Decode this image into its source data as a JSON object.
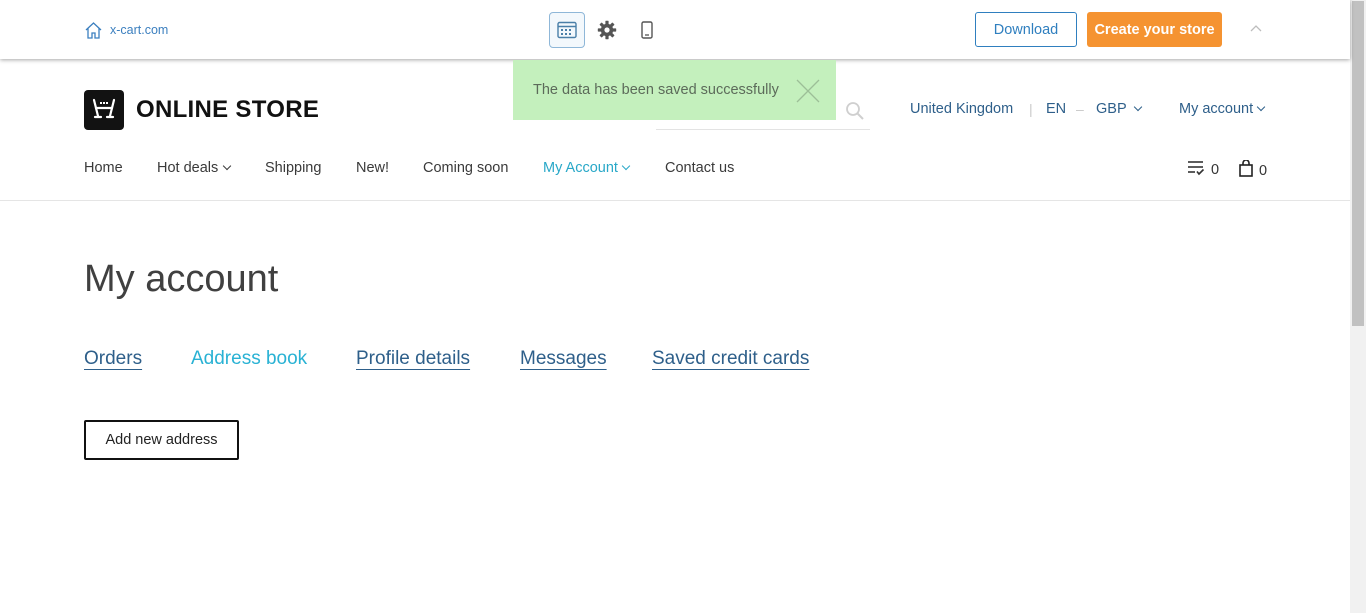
{
  "demo_bar": {
    "home_link": "x-cart.com",
    "download_label": "Download",
    "create_store_label": "Create your store"
  },
  "header": {
    "logo_text": "ONLINE STORE",
    "country": "United Kingdom",
    "language": "EN",
    "currency": "GBP",
    "account": "My account"
  },
  "toast": {
    "message": "The data has been saved successfully"
  },
  "nav": {
    "items": [
      {
        "label": "Home"
      },
      {
        "label": "Hot deals"
      },
      {
        "label": "Shipping"
      },
      {
        "label": "New!"
      },
      {
        "label": "Coming soon"
      },
      {
        "label": "My Account"
      },
      {
        "label": "Contact us"
      }
    ],
    "comparison_count": "0",
    "cart_count": "0"
  },
  "main": {
    "title": "My account",
    "tabs": [
      {
        "label": "Orders"
      },
      {
        "label": "Address book"
      },
      {
        "label": "Profile details"
      },
      {
        "label": "Messages"
      },
      {
        "label": "Saved credit cards"
      }
    ],
    "add_address_label": "Add new address"
  },
  "colors": {
    "accent": "#29a8c8",
    "link": "#2e5f8a",
    "orange_button": "#f59331",
    "toast_bg": "#c4f0bd"
  }
}
